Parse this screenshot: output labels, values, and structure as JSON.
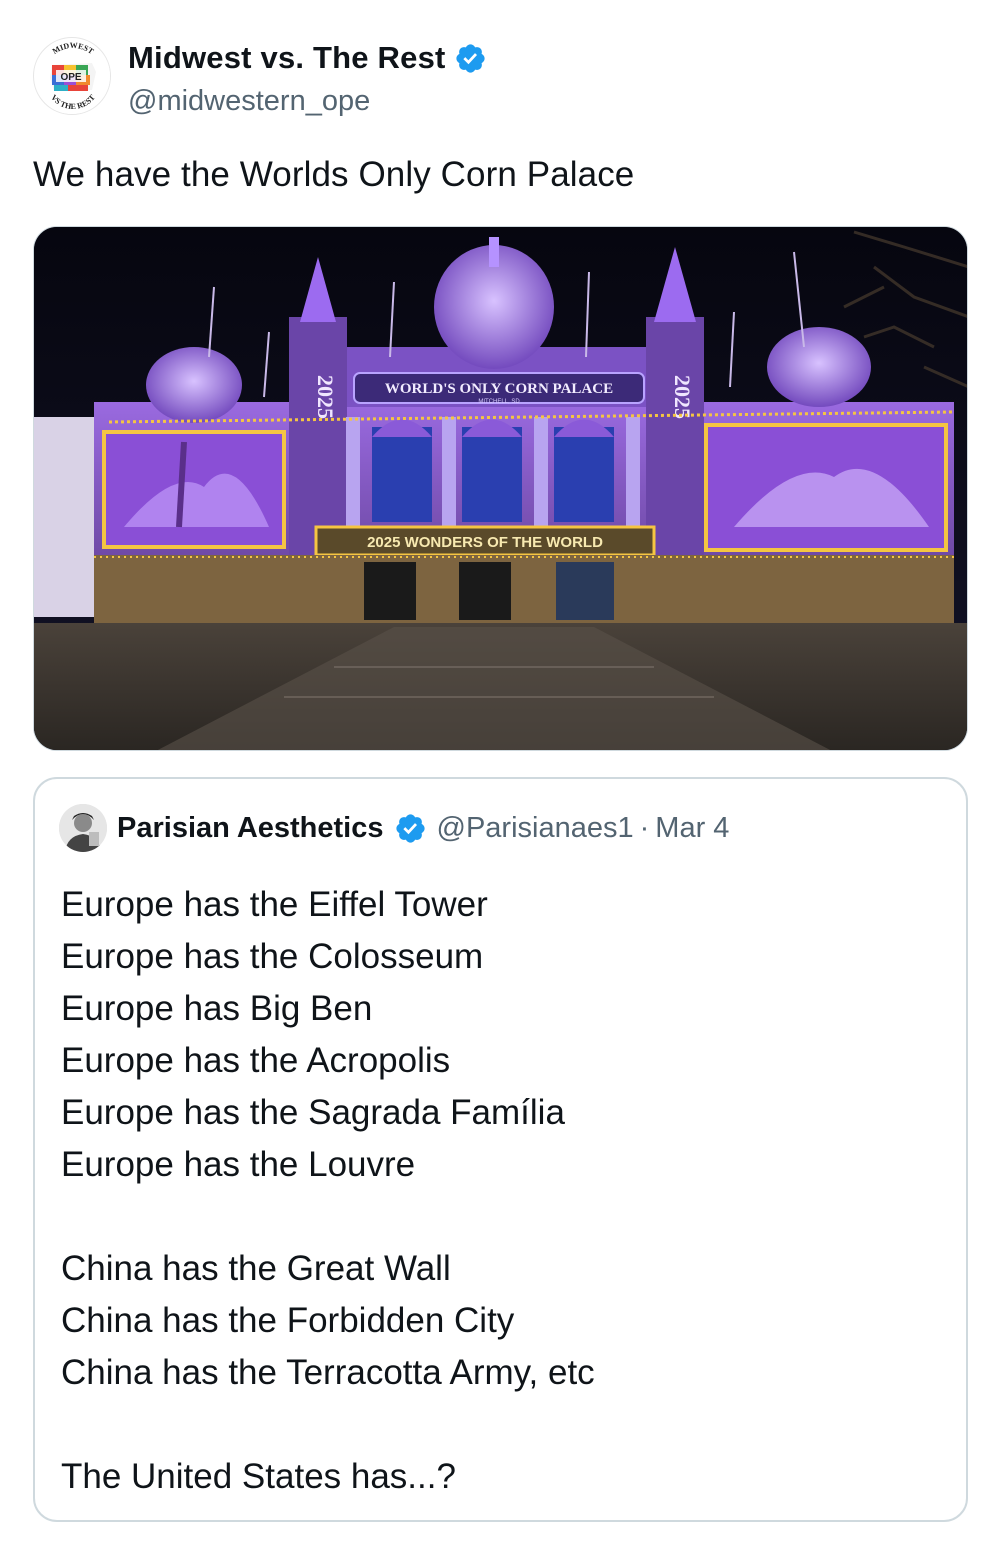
{
  "author": {
    "display_name": "Midwest vs. The Rest",
    "handle": "@midwestern_ope",
    "verified_icon": "verified-badge-icon",
    "avatar_text_top": "MIDWEST",
    "avatar_text_center": "OPE",
    "avatar_text_bottom": "VS THE REST"
  },
  "tweet": {
    "text": "We have the Worlds Only Corn Palace"
  },
  "media": {
    "banner_top": "WORLD'S ONLY CORN PALACE",
    "banner_sub": "MITCHELL, SD",
    "banner_bottom": "2025 WONDERS OF THE WORLD",
    "tower_text_left": "2025",
    "tower_text_right": "2025",
    "colors": {
      "sky": "#0b0b1a",
      "purple": "#8a4fd6",
      "light_purple": "#c9a6ff",
      "lights": "#f5c542",
      "ground": "#3a3530"
    }
  },
  "quote": {
    "display_name": "Parisian Aesthetics",
    "handle": "@Parisianaes1",
    "separator": "·",
    "date": "Mar 4",
    "lines": [
      "Europe has the Eiffel Tower",
      "Europe has the Colosseum",
      "Europe has Big Ben",
      "Europe has the Acropolis",
      "Europe has the Sagrada Família",
      "Europe has the Louvre",
      "",
      "China has the Great Wall",
      "China has the Forbidden City",
      "China has the Terracotta Army, etc",
      "",
      "The United States has...?"
    ]
  },
  "accent_color": "#1d9bf0"
}
